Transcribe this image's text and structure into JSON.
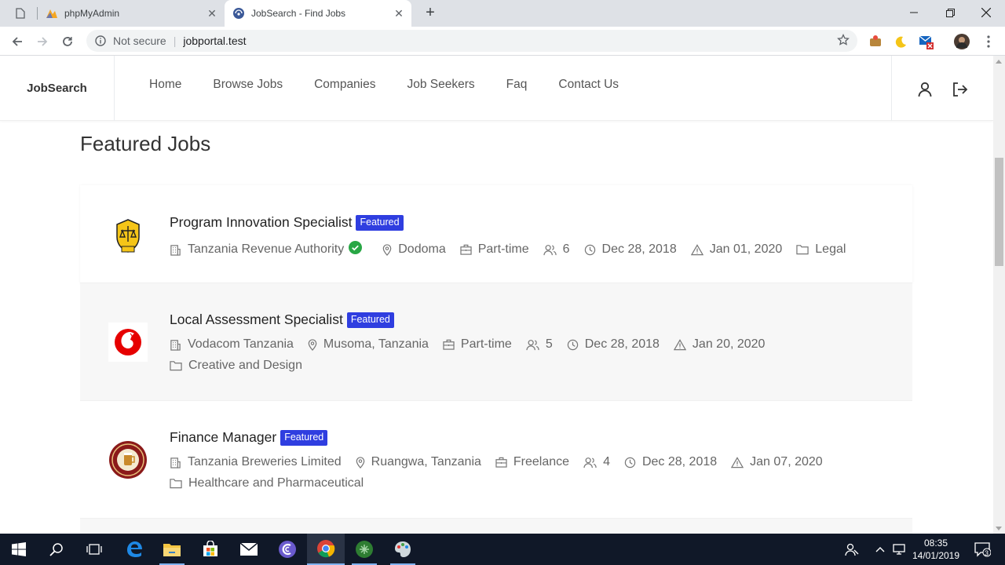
{
  "browser": {
    "tabs": [
      {
        "title": ""
      },
      {
        "title": "phpMyAdmin"
      },
      {
        "title": "JobSearch - Find Jobs"
      }
    ],
    "security_label": "Not secure",
    "url": "jobportal.test"
  },
  "site": {
    "brand": "JobSearch",
    "nav": [
      "Home",
      "Browse Jobs",
      "Companies",
      "Job Seekers",
      "Faq",
      "Contact Us"
    ]
  },
  "section_title": "Featured Jobs",
  "jobs": [
    {
      "title": "Program Innovation Specialist",
      "badge": "Featured",
      "company": "Tanzania Revenue Authority",
      "verified": true,
      "location": "Dodoma",
      "type": "Part-time",
      "positions": "6",
      "posted": "Dec 28, 2018",
      "deadline": "Jan 01, 2020",
      "category": "Legal"
    },
    {
      "title": "Local Assessment Specialist",
      "badge": "Featured",
      "company": "Vodacom Tanzania",
      "verified": false,
      "location": "Musoma, Tanzania",
      "type": "Part-time",
      "positions": "5",
      "posted": "Dec 28, 2018",
      "deadline": "Jan 20, 2020",
      "category": "Creative and Design"
    },
    {
      "title": "Finance Manager",
      "badge": "Featured",
      "company": "Tanzania Breweries Limited",
      "verified": false,
      "location": "Ruangwa, Tanzania",
      "type": "Freelance",
      "positions": "4",
      "posted": "Dec 28, 2018",
      "deadline": "Jan 07, 2020",
      "category": "Healthcare and Pharmaceutical"
    }
  ],
  "taskbar": {
    "time": "08:35",
    "date": "14/01/2019",
    "notifications": "3"
  },
  "colors": {
    "badge": "#2f3ee0",
    "verified": "#28a745",
    "taskbar": "#101828"
  }
}
